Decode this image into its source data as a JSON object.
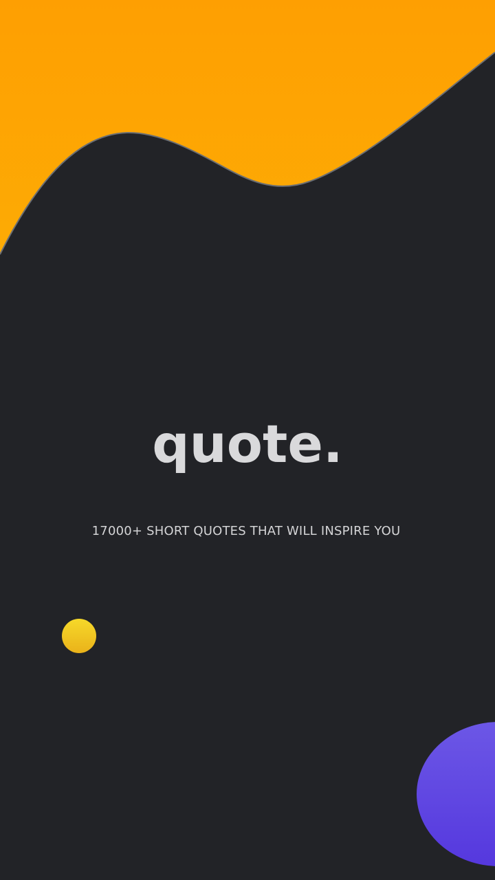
{
  "app": {
    "title": "quote.",
    "tagline": "17000+ SHORT QUOTES THAT WILL INSPIRE YOU"
  },
  "colors": {
    "background": "#222327",
    "wave": "#fca404",
    "wave_edge": "#6b6e73",
    "yellow_dot": "#f2cb22",
    "purple_blob": "#5f46e2",
    "text": "#d9d9db"
  },
  "decorations": [
    "orange-wave",
    "yellow-dot",
    "purple-blob"
  ]
}
